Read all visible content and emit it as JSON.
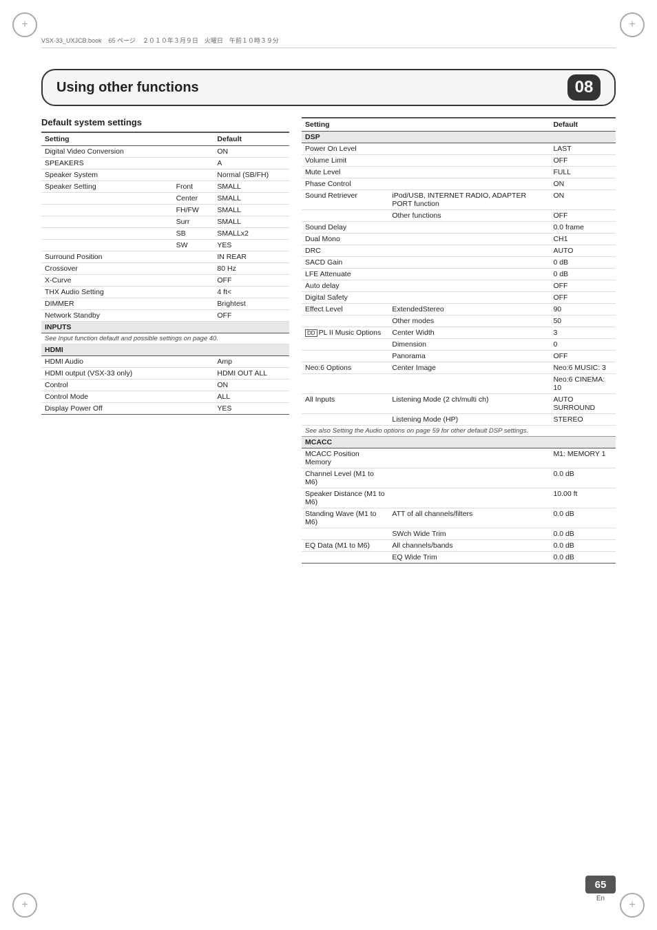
{
  "meta": {
    "file": "VSX-33_UXJCB.book",
    "page": "65 ページ",
    "date": "２０１０年３月９日　火曜日　午前１０時３９分"
  },
  "chapter": {
    "title": "Using other functions",
    "number": "08"
  },
  "left_section": {
    "title": "Default system settings",
    "table": {
      "headers": [
        "Setting",
        "",
        "Default"
      ],
      "rows": [
        {
          "setting": "Digital Video Conversion",
          "sub": "",
          "default": "ON"
        },
        {
          "setting": "SPEAKERS",
          "sub": "",
          "default": "A"
        },
        {
          "setting": "Speaker System",
          "sub": "",
          "default": "Normal (SB/FH)"
        },
        {
          "setting": "Speaker Setting",
          "sub": "Front",
          "default": "SMALL"
        },
        {
          "setting": "",
          "sub": "Center",
          "default": "SMALL"
        },
        {
          "setting": "",
          "sub": "FH/FW",
          "default": "SMALL"
        },
        {
          "setting": "",
          "sub": "Surr",
          "default": "SMALL"
        },
        {
          "setting": "",
          "sub": "SB",
          "default": "SMALLx2"
        },
        {
          "setting": "",
          "sub": "SW",
          "default": "YES"
        },
        {
          "setting": "Surround Position",
          "sub": "",
          "default": "IN REAR"
        },
        {
          "setting": "Crossover",
          "sub": "",
          "default": "80 Hz"
        },
        {
          "setting": "X-Curve",
          "sub": "",
          "default": "OFF"
        },
        {
          "setting": "THX Audio Setting",
          "sub": "",
          "default": "4 ft<"
        },
        {
          "setting": "DIMMER",
          "sub": "",
          "default": "Brightest"
        },
        {
          "setting": "Network Standby",
          "sub": "",
          "default": "OFF"
        },
        {
          "setting": "INPUTS",
          "sub": "",
          "default": "",
          "bold": true
        },
        {
          "setting": "See Input function default and possible settings on page 40.",
          "sub": "",
          "default": "",
          "note": true
        },
        {
          "setting": "HDMI",
          "sub": "",
          "default": "",
          "bold": true
        },
        {
          "setting": "HDMI Audio",
          "sub": "",
          "default": "Amp"
        },
        {
          "setting": "HDMI output (VSX-33 only)",
          "sub": "",
          "default": "HDMI OUT ALL"
        },
        {
          "setting": "Control",
          "sub": "",
          "default": "ON"
        },
        {
          "setting": "Control Mode",
          "sub": "",
          "default": "ALL"
        },
        {
          "setting": "Display Power Off",
          "sub": "",
          "default": "YES"
        }
      ]
    }
  },
  "right_section": {
    "table": {
      "headers": [
        "Setting",
        "",
        "Default"
      ],
      "rows": [
        {
          "setting": "DSP",
          "sub": "",
          "default": "",
          "bold": true
        },
        {
          "setting": "Power On Level",
          "sub": "",
          "default": "LAST"
        },
        {
          "setting": "Volume Limit",
          "sub": "",
          "default": "OFF"
        },
        {
          "setting": "Mute Level",
          "sub": "",
          "default": "FULL"
        },
        {
          "setting": "Phase Control",
          "sub": "",
          "default": "ON"
        },
        {
          "setting": "Sound Retriever",
          "sub": "iPod/USB, INTERNET RADIO, ADAPTER PORT function",
          "default": "ON"
        },
        {
          "setting": "",
          "sub": "Other functions",
          "default": "OFF"
        },
        {
          "setting": "Sound Delay",
          "sub": "",
          "default": "0.0 frame"
        },
        {
          "setting": "Dual Mono",
          "sub": "",
          "default": "CH1"
        },
        {
          "setting": "DRC",
          "sub": "",
          "default": "AUTO"
        },
        {
          "setting": "SACD Gain",
          "sub": "",
          "default": "0 dB"
        },
        {
          "setting": "LFE Attenuate",
          "sub": "",
          "default": "0 dB"
        },
        {
          "setting": "Auto delay",
          "sub": "",
          "default": "OFF"
        },
        {
          "setting": "Digital Safety",
          "sub": "",
          "default": "OFF"
        },
        {
          "setting": "Effect Level",
          "sub": "ExtendedStereo",
          "default": "90"
        },
        {
          "setting": "",
          "sub": "Other modes",
          "default": "50"
        },
        {
          "setting": "PL II Music Options",
          "sub": "Center Width",
          "default": "3"
        },
        {
          "setting": "",
          "sub": "Dimension",
          "default": "0"
        },
        {
          "setting": "",
          "sub": "Panorama",
          "default": "OFF"
        },
        {
          "setting": "Neo:6 Options",
          "sub": "Center Image",
          "default": "Neo:6 MUSIC: 3"
        },
        {
          "setting": "",
          "sub": "",
          "default": "Neo:6 CINEMA: 10"
        },
        {
          "setting": "All Inputs",
          "sub": "Listening Mode (2 ch/multi ch)",
          "default": "AUTO SURROUND"
        },
        {
          "setting": "",
          "sub": "Listening Mode (HP)",
          "default": "STEREO"
        },
        {
          "setting": "note1",
          "note": true,
          "setting_text": "See also Setting the Audio options on page 59 for other default DSP settings."
        },
        {
          "setting": "MCACC",
          "sub": "",
          "default": "",
          "bold": true
        },
        {
          "setting": "MCACC Position Memory",
          "sub": "",
          "default": "M1: MEMORY 1"
        },
        {
          "setting": "Channel Level (M1 to M6)",
          "sub": "",
          "default": "0.0 dB"
        },
        {
          "setting": "Speaker Distance (M1 to M6)",
          "sub": "",
          "default": "10.00 ft"
        },
        {
          "setting": "Standing Wave (M1 to M6)",
          "sub": "ATT of all channels/filters",
          "default": "0.0 dB"
        },
        {
          "setting": "",
          "sub": "SWch Wide Trim",
          "default": "0.0 dB"
        },
        {
          "setting": "EQ Data (M1 to M6)",
          "sub": "All channels/bands",
          "default": "0.0 dB"
        },
        {
          "setting": "",
          "sub": "EQ Wide Trim",
          "default": "0.0 dB"
        }
      ]
    }
  },
  "footer": {
    "page_number": "65",
    "language": "En"
  }
}
